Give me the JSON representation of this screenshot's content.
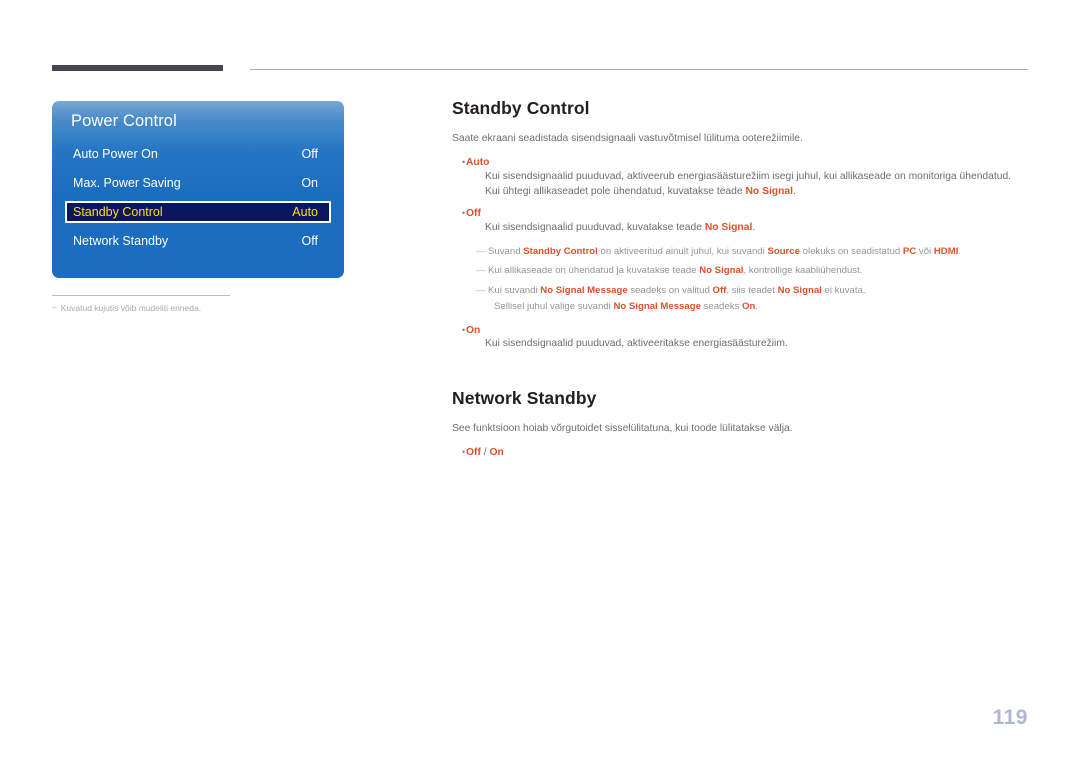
{
  "page": {
    "number": "119"
  },
  "osd": {
    "title": "Power Control",
    "rows": [
      {
        "label": "Auto Power On",
        "value": "Off",
        "selected": false
      },
      {
        "label": "Max. Power Saving",
        "value": "On",
        "selected": false
      },
      {
        "label": "Standby Control",
        "value": "Auto",
        "selected": true
      },
      {
        "label": "Network Standby",
        "value": "Off",
        "selected": false
      }
    ],
    "caption": "Kuvatud kujutis võib mudeliti erineda.",
    "caption_dash": "–",
    "colors": {
      "panel_top": "#7ba7d4",
      "panel_bottom": "#1d6cc0",
      "selected_bg": "#0b1560",
      "selected_text": "#ffe000",
      "text": "#ffffff"
    }
  },
  "sections": {
    "standby_control": {
      "heading": "Standby Control",
      "intro": "Saate ekraani seadistada sisendsignaali vastuvõtmisel lülituma ooterežiimile.",
      "bullet_auto_term": "Auto",
      "bullet_auto_line1": "Kui sisendsignaalid puuduvad, aktiveerub energiasäästurežiim isegi juhul, kui allikaseade on monitoriga ühendatud.",
      "bullet_auto_line2_pre": "Kui ühtegi allikaseadet pole ühendatud, kuvatakse teade ",
      "bullet_auto_line2_em": "No Signal",
      "bullet_auto_line2_post": ".",
      "bullet_off_term": "Off",
      "bullet_off_line1_pre": "Kui sisendsignaalid puuduvad, kuvatakse teade ",
      "bullet_off_line1_em": "No Signal",
      "bullet_off_line1_post": ".",
      "note1_dash": "—",
      "note1_a": "Suvand ",
      "note1_em1": "Standby Control",
      "note1_b": " on aktiveeritud ainult juhul, kui suvandi ",
      "note1_em2": "Source",
      "note1_c": " olekuks on seadistatud ",
      "note1_em3": "PC",
      "note1_d": " või ",
      "note1_em4": "HDMI",
      "note1_e": ".",
      "note2_a": "Kui allikaseade on ühendatud ja kuvatakse teade ",
      "note2_em1": "No Signal",
      "note2_b": ", kontrollige kaabliühendust.",
      "note3_a": "Kui suvandi ",
      "note3_em1": "No Signal Message",
      "note3_b": " seadeks on valitud ",
      "note3_em2": "Off",
      "note3_c": ", siis teadet ",
      "note3_em3": "No Signal",
      "note3_d": " ei kuvata.",
      "note3_cont_a": "Sellisel juhul valige suvandi ",
      "note3_cont_em1": "No Signal Message",
      "note3_cont_b": " seadeks ",
      "note3_cont_em2": "On",
      "note3_cont_c": ".",
      "bullet_on_term": "On",
      "bullet_on_line1": "Kui sisendsignaalid puuduvad, aktiveeritakse energiasäästurežiim."
    },
    "network_standby": {
      "heading": "Network Standby",
      "intro": "See funktsioon hoiab võrgutoidet sisselülitatuna, kui toode lülitatakse välja.",
      "bullet_term_off": "Off",
      "bullet_separator": " / ",
      "bullet_term_on": "On"
    }
  },
  "icons": {
    "bullet": "•"
  }
}
